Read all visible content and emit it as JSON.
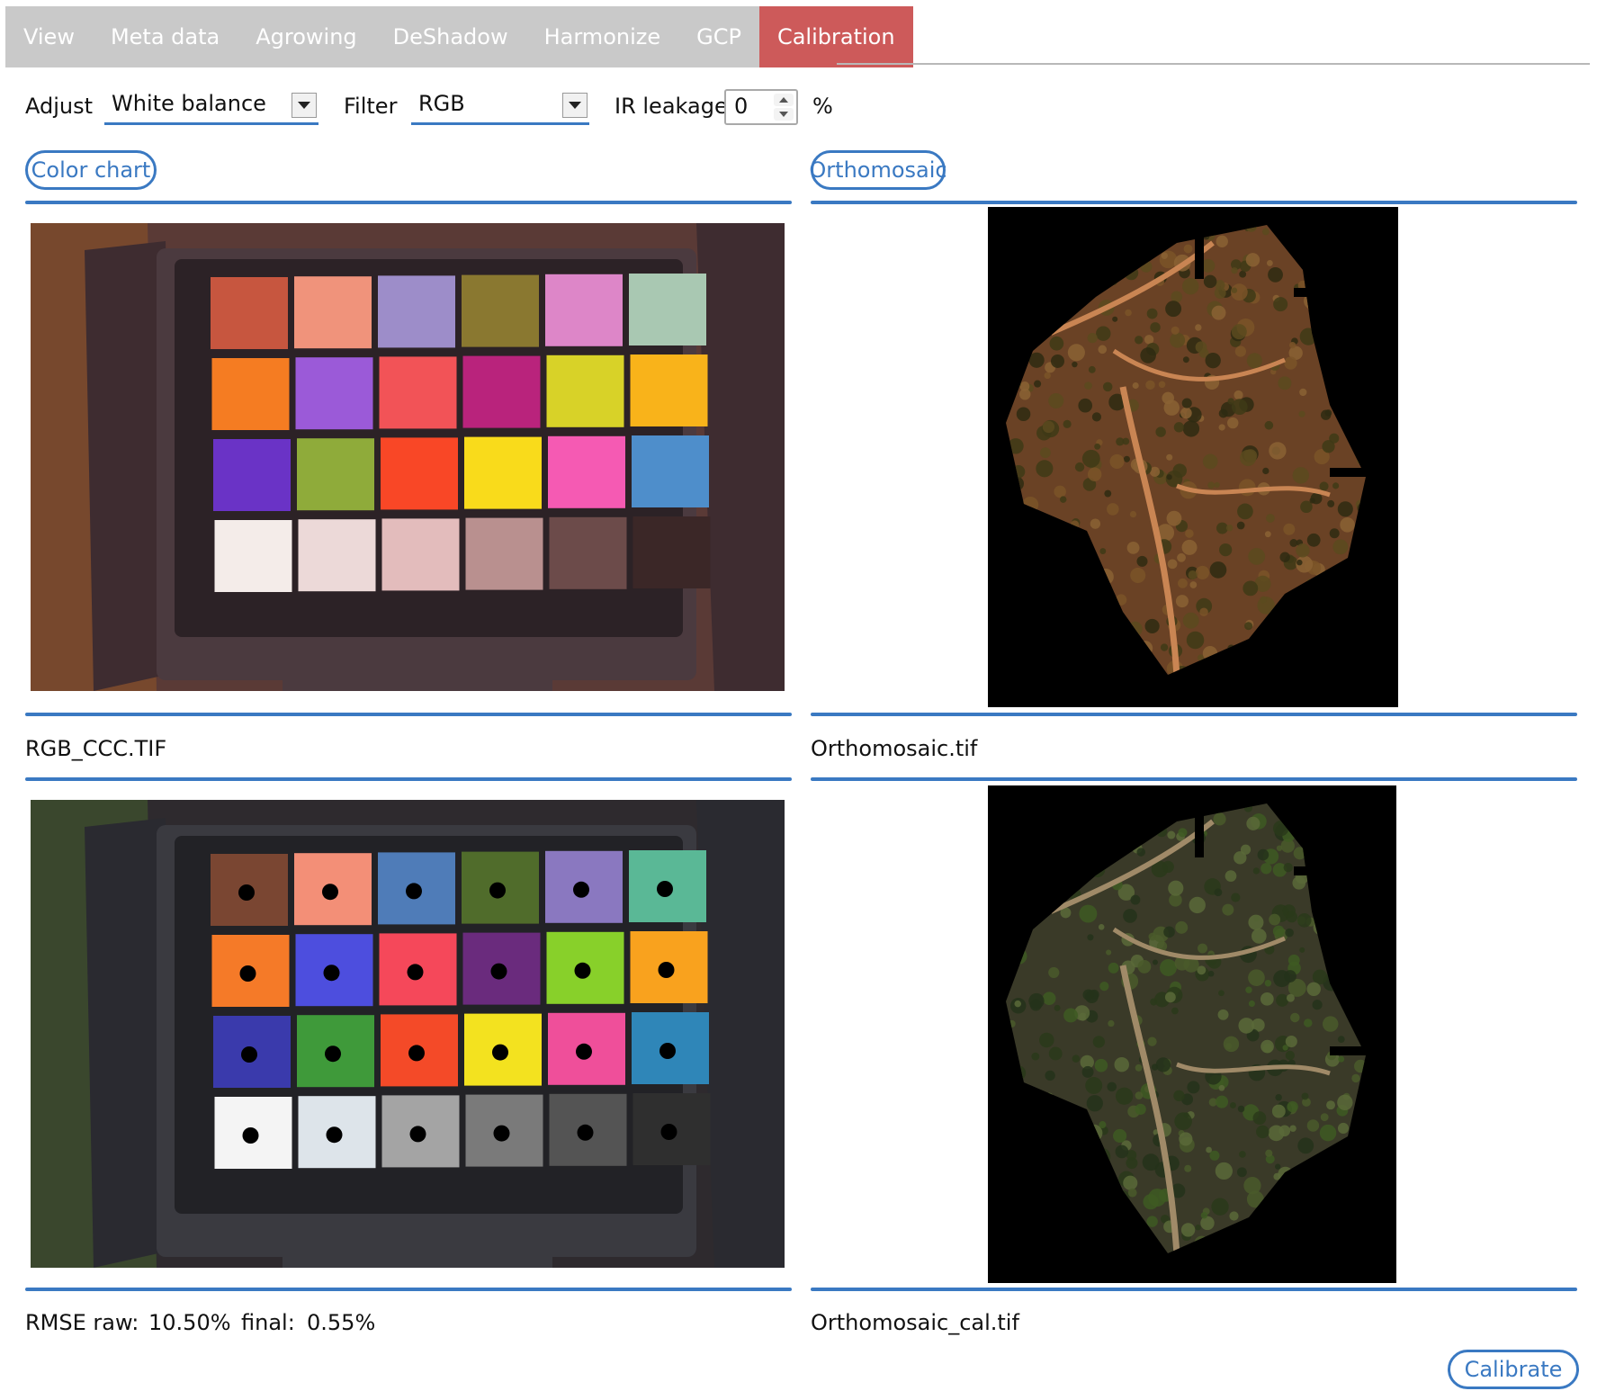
{
  "tabs": [
    {
      "label": "View",
      "active": false
    },
    {
      "label": "Meta data",
      "active": false
    },
    {
      "label": "Agrowing",
      "active": false
    },
    {
      "label": "DeShadow",
      "active": false
    },
    {
      "label": "Harmonize",
      "active": false
    },
    {
      "label": "GCP",
      "active": false
    },
    {
      "label": "Calibration",
      "active": true
    }
  ],
  "controls": {
    "adjust_label": "Adjust",
    "adjust_value": "White balance",
    "filter_label": "Filter",
    "filter_value": "RGB",
    "ir_label": "IR leakage",
    "ir_value": "0",
    "ir_unit": "%"
  },
  "left": {
    "button": "Color chart",
    "top_file": "RGB_CCC.TIF",
    "rmse_label": "RMSE raw:",
    "rmse_raw": "10.50%",
    "final_label": "final:",
    "rmse_final": "0.55%"
  },
  "right": {
    "button": "Orthomosaic",
    "top_file": "Orthomosaic.tif",
    "bottom_file": "Orthomosaic_cal.tif"
  },
  "calibrate_label": "Calibrate",
  "colors": {
    "accent": "#3a79c2",
    "active_tab": "#cd5a5a",
    "tab_bar": "#c9c9c9"
  },
  "chart_raw": [
    [
      "#c7563f",
      "#f0937b",
      "#9d8dc9",
      "#8a7830",
      "#dd86c8",
      "#a9c8b2"
    ],
    [
      "#f57c22",
      "#9b5ad8",
      "#f25357",
      "#b9237c",
      "#d8d228",
      "#f9b31a"
    ],
    [
      "#6a33c6",
      "#8fab3a",
      "#f94726",
      "#f9db1b",
      "#f55ab3",
      "#4e8ecb"
    ],
    [
      "#f4ece9",
      "#ecd9d8",
      "#e3bcbc",
      "#b9908f",
      "#6c4b4a",
      "#3b2727"
    ]
  ],
  "chart_cal": [
    [
      "#7a4632",
      "#f38f77",
      "#4f7cb8",
      "#506c2b",
      "#8a78c0",
      "#5ab896"
    ],
    [
      "#f57a28",
      "#4d4ede",
      "#f5485a",
      "#6a2b7d",
      "#88d02a",
      "#f9a21e"
    ],
    [
      "#3a3aac",
      "#3f9a3a",
      "#f44a28",
      "#f3e21f",
      "#ef4f9a",
      "#2f86b8"
    ],
    [
      "#f4f4f4",
      "#dde4ea",
      "#a4a4a4",
      "#7a7a7a",
      "#545454",
      "#2f2f2f"
    ]
  ]
}
